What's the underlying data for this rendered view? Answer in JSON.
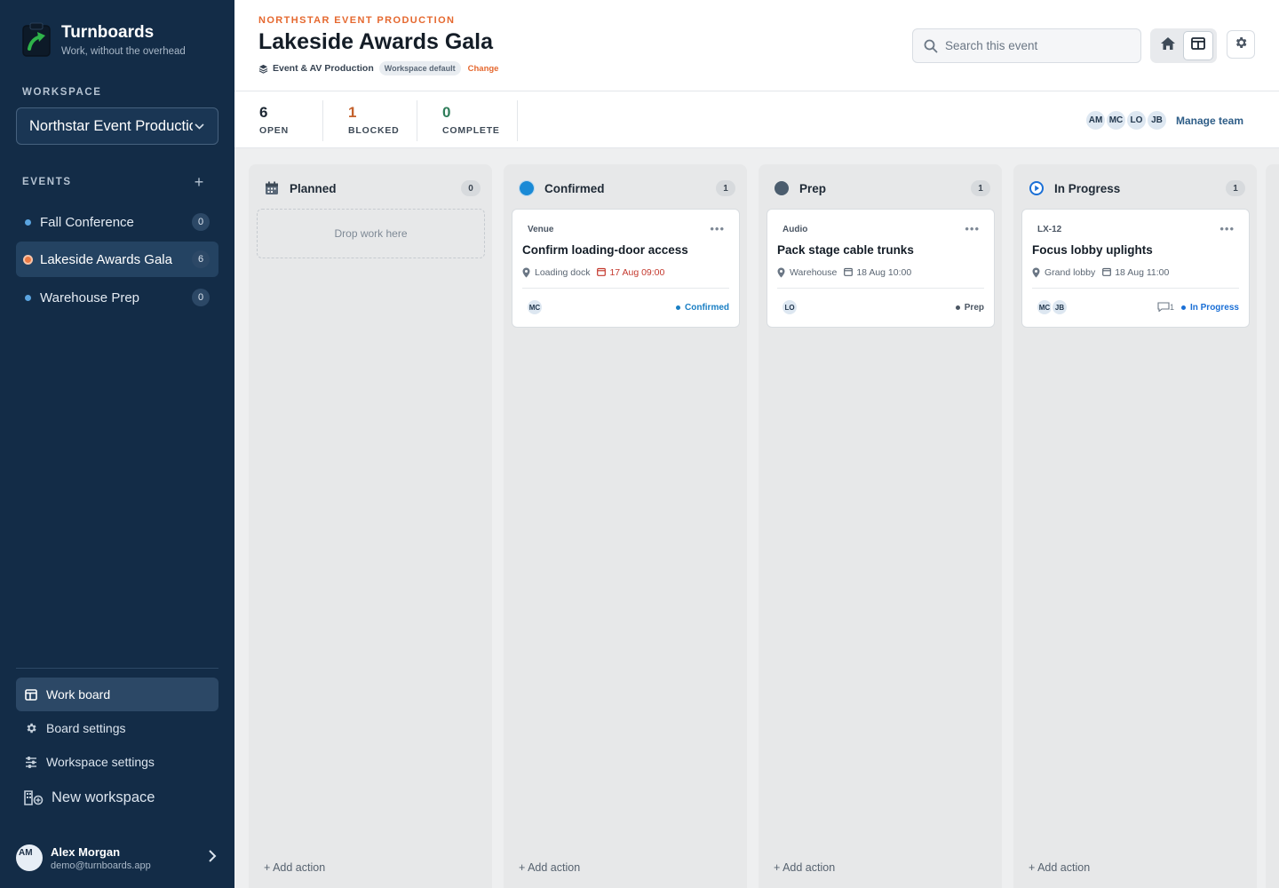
{
  "app": {
    "name": "Turnboards",
    "tagline": "Work, without the overhead"
  },
  "sidebar": {
    "workspace_label": "WORKSPACE",
    "workspace_value": "Northstar Event Production",
    "events_label": "EVENTS",
    "events": [
      {
        "label": "Fall Conference",
        "count": "0"
      },
      {
        "label": "Lakeside Awards Gala",
        "count": "6"
      },
      {
        "label": "Warehouse Prep",
        "count": "0"
      }
    ],
    "nav": {
      "work_board": "Work board",
      "board_settings": "Board settings",
      "workspace_settings": "Workspace settings",
      "new_workspace": "New workspace"
    },
    "user": {
      "initials": "AM",
      "name": "Alex Morgan",
      "email": "demo@turnboards.app"
    }
  },
  "header": {
    "overline": "NORTHSTAR EVENT PRODUCTION",
    "title": "Lakeside Awards Gala",
    "profile": "Event & AV Production",
    "profile_badge": "Workspace default",
    "change": "Change",
    "search_placeholder": "Search this event"
  },
  "stats": [
    {
      "value": "6",
      "label": "OPEN",
      "color": "#1c2733"
    },
    {
      "value": "1",
      "label": "BLOCKED",
      "color": "#c4622d"
    },
    {
      "value": "0",
      "label": "COMPLETE",
      "color": "#2f7d5a"
    }
  ],
  "team": {
    "members": [
      "AM",
      "MC",
      "LO",
      "JB"
    ],
    "manage": "Manage team"
  },
  "board": {
    "dropzone": "Drop work here",
    "add_action": "+ Add action",
    "columns": [
      {
        "title": "Planned",
        "count": "0",
        "icon": "calendar-icon"
      },
      {
        "title": "Confirmed",
        "count": "1",
        "icon": "circle-icon",
        "color": "#1a8ad6",
        "card": {
          "category": "Venue",
          "title": "Confirm loading-door access",
          "location": "Loading dock",
          "due": "17 Aug 09:00",
          "assignees": [
            "MC"
          ],
          "status": "Confirmed",
          "status_color": "#1a7fc4"
        }
      },
      {
        "title": "Prep",
        "count": "1",
        "icon": "circle-icon",
        "color": "#4b5d6e",
        "card": {
          "category": "Audio",
          "title": "Pack stage cable trunks",
          "location": "Warehouse",
          "due": "18 Aug 10:00",
          "assignees": [
            "LO"
          ],
          "status": "Prep",
          "status_color": "#4b5663"
        }
      },
      {
        "title": "In Progress",
        "count": "1",
        "icon": "play-circle-icon",
        "color": "#1a6fd6",
        "card": {
          "category": "LX-12",
          "title": "Focus lobby uplights",
          "location": "Grand lobby",
          "due": "18 Aug 11:00",
          "assignees": [
            "MC",
            "JB"
          ],
          "comments": "1",
          "status": "In Progress",
          "status_color": "#1a6fd6"
        }
      }
    ]
  },
  "colors": {
    "sidebar_bg": "#132c47",
    "accent": "#e5682f",
    "due_overdue": "#c4392e"
  }
}
